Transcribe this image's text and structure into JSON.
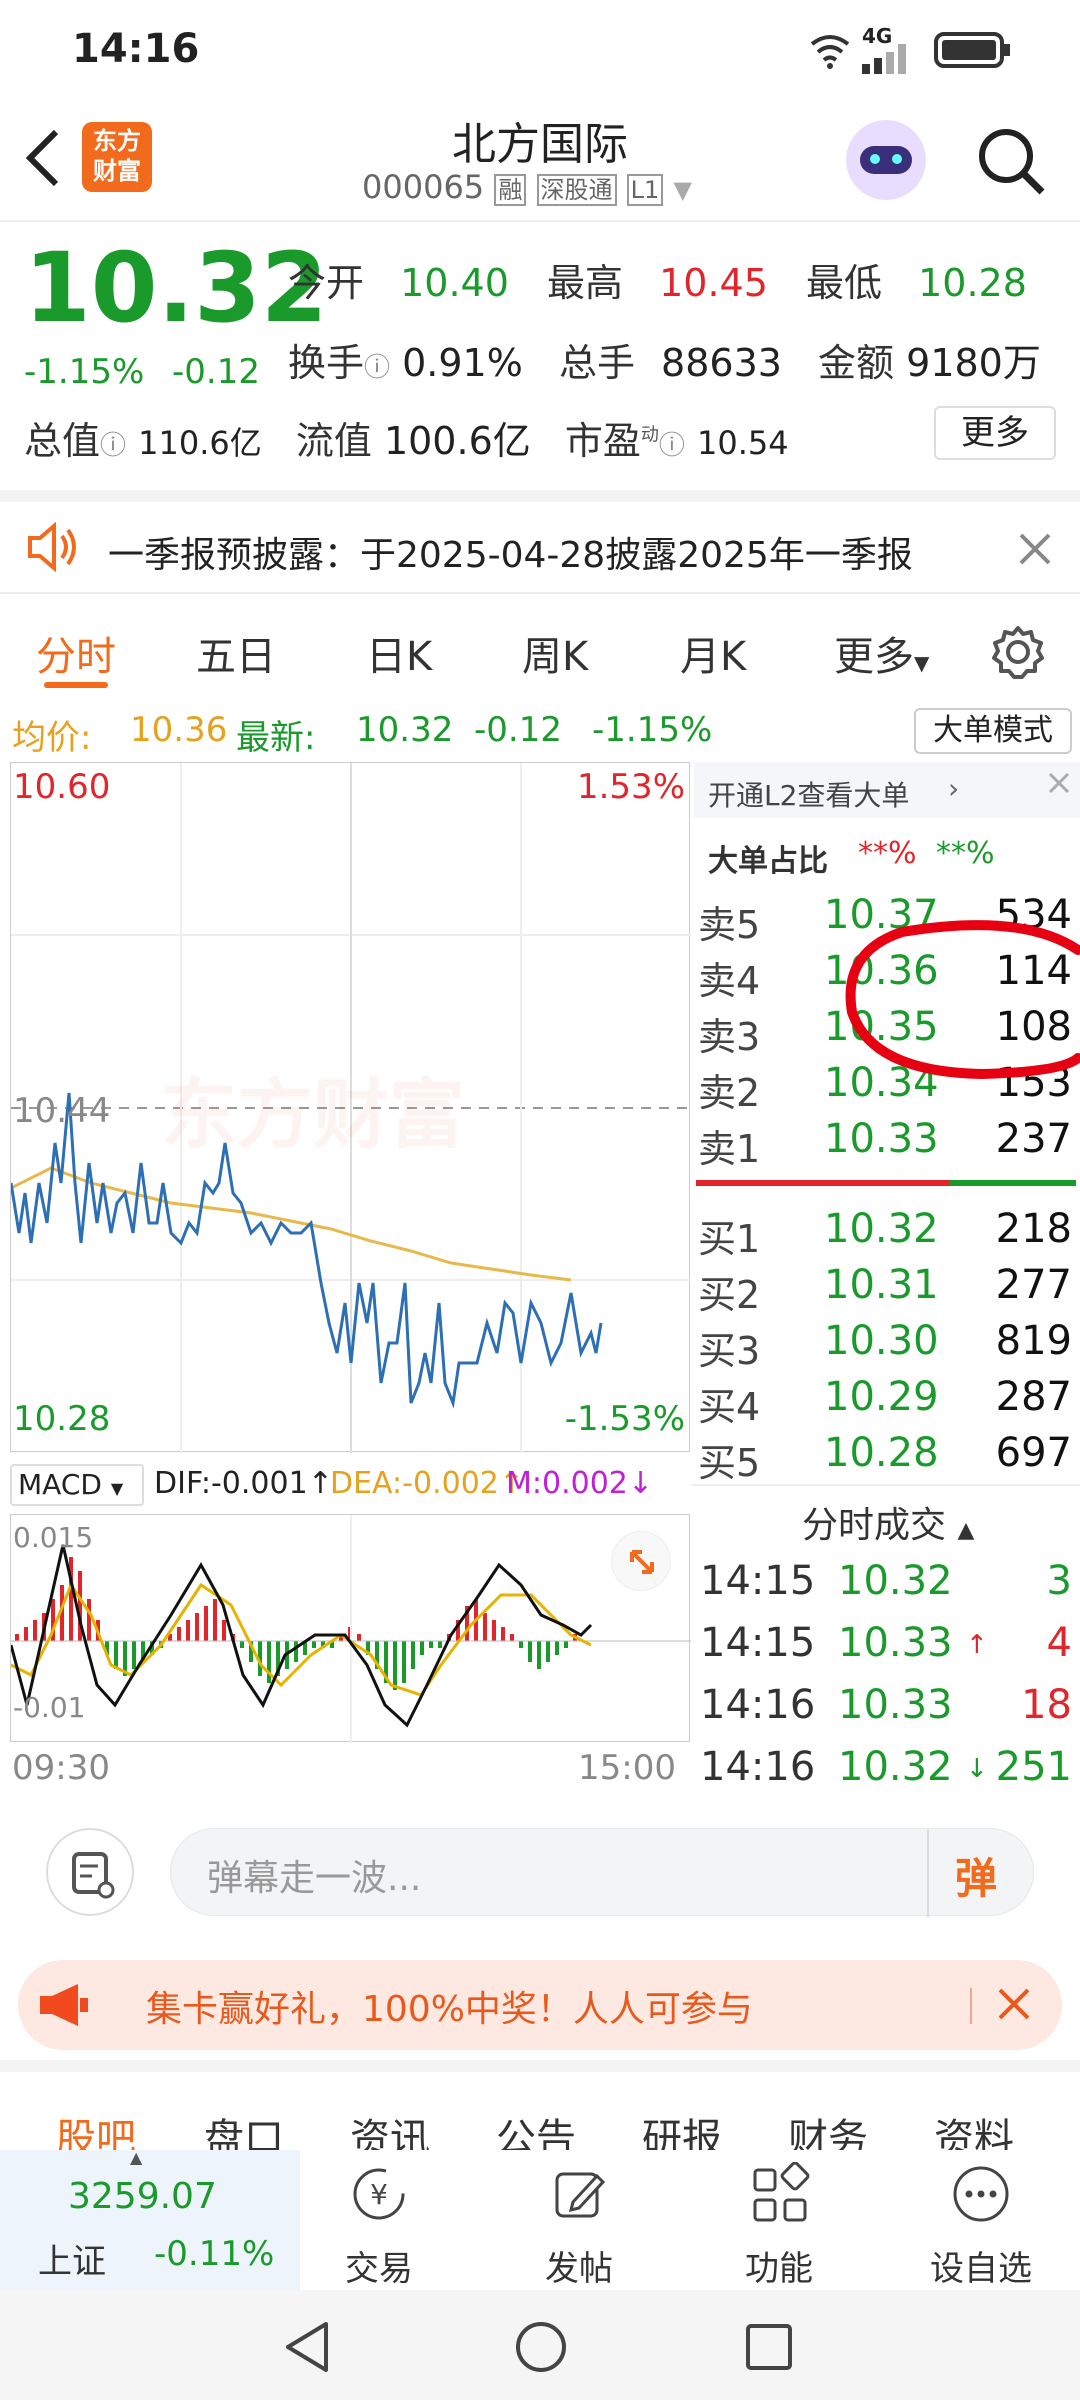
{
  "status": {
    "time": "14:16",
    "network": "4G"
  },
  "header": {
    "logo_line1": "东方",
    "logo_line2": "财富",
    "title": "北方国际",
    "code": "000065",
    "tag_rong": "融",
    "tag_sgt": "深股通",
    "tag_level": "L1"
  },
  "quote": {
    "price": "10.32",
    "change_pct": "-1.15%",
    "change": "-0.12",
    "open_label": "今开",
    "open": "10.40",
    "high_label": "最高",
    "high": "10.45",
    "low_label": "最低",
    "low": "10.28",
    "turnover_label": "换手",
    "turnover": "0.91%",
    "volume_label": "总手",
    "volume": "88633",
    "amount_label": "金额",
    "amount": "9180万",
    "mktcap_label": "总值",
    "mktcap": "110.6亿",
    "float_label": "流值",
    "float": "100.6亿",
    "pe_label": "市盈",
    "pe_sup": "动",
    "pe": "10.54",
    "more_button": "更多"
  },
  "notice": {
    "text": "一季报预披露：于2025-04-28披露2025年一季报"
  },
  "tabs": [
    {
      "label": "分时"
    },
    {
      "label": "五日"
    },
    {
      "label": "日K"
    },
    {
      "label": "周K"
    },
    {
      "label": "月K"
    },
    {
      "label": "更多"
    }
  ],
  "avg_bar": {
    "avg_label": "均价:",
    "avg": "10.36",
    "latest_label": "最新:",
    "latest": "10.32",
    "chg": "-0.12",
    "pct": "-1.15%",
    "mode_button": "大单模式"
  },
  "chart": {
    "price_top": "10.60",
    "pct_top": "1.53%",
    "price_mid": "10.44",
    "price_bottom": "10.28",
    "pct_bottom": "-1.53%",
    "watermark": "东方财富",
    "time_start": "09:30",
    "time_end": "15:00"
  },
  "macd": {
    "selector": "MACD",
    "dif": "DIF:-0.001",
    "dea": "DEA:-0.002",
    "m": "M:0.002",
    "top": "0.015",
    "bottom": "-0.01"
  },
  "level2": {
    "promo": "开通L2查看大单",
    "ratio_label": "大单占比",
    "ratio_red": "**%",
    "ratio_green": "**%"
  },
  "orderbook": {
    "asks": [
      {
        "label": "卖5",
        "price": "10.37",
        "vol": "534"
      },
      {
        "label": "卖4",
        "price": "10.36",
        "vol": "114"
      },
      {
        "label": "卖3",
        "price": "10.35",
        "vol": "108"
      },
      {
        "label": "卖2",
        "price": "10.34",
        "vol": "153"
      },
      {
        "label": "卖1",
        "price": "10.33",
        "vol": "237"
      }
    ],
    "bids": [
      {
        "label": "买1",
        "price": "10.32",
        "vol": "218"
      },
      {
        "label": "买2",
        "price": "10.31",
        "vol": "277"
      },
      {
        "label": "买3",
        "price": "10.30",
        "vol": "819"
      },
      {
        "label": "买4",
        "price": "10.29",
        "vol": "287"
      },
      {
        "label": "买5",
        "price": "10.28",
        "vol": "697"
      }
    ]
  },
  "trades": {
    "header": "分时成交",
    "rows": [
      {
        "time": "14:15",
        "price": "10.32",
        "arrow": "",
        "vol": "3"
      },
      {
        "time": "14:15",
        "price": "10.33",
        "arrow": "↑",
        "vol": "4"
      },
      {
        "time": "14:16",
        "price": "10.33",
        "arrow": "",
        "vol": "18"
      },
      {
        "time": "14:16",
        "price": "10.32",
        "arrow": "↓",
        "vol": "251"
      }
    ]
  },
  "comment": {
    "placeholder": "弹幕走一波...",
    "danmu_button": "弹"
  },
  "banner": {
    "text": "集卡赢好礼，100%中奖！人人可参与"
  },
  "bottom_tabs": [
    {
      "label": "股吧"
    },
    {
      "label": "盘口"
    },
    {
      "label": "资讯"
    },
    {
      "label": "公告"
    },
    {
      "label": "研报"
    },
    {
      "label": "财务"
    },
    {
      "label": "资料"
    }
  ],
  "bottom_bar": {
    "index_value": "3259.07",
    "index_name": "上证",
    "index_pct": "-0.11%",
    "trade": "交易",
    "post": "发帖",
    "function": "功能",
    "watchlist": "设自选"
  },
  "colors": {
    "up": "#e0262b",
    "down": "#1a9a2b",
    "accent": "#f26a1b",
    "price_line": "#2c6fb5",
    "avg_line": "#e9b84a"
  }
}
